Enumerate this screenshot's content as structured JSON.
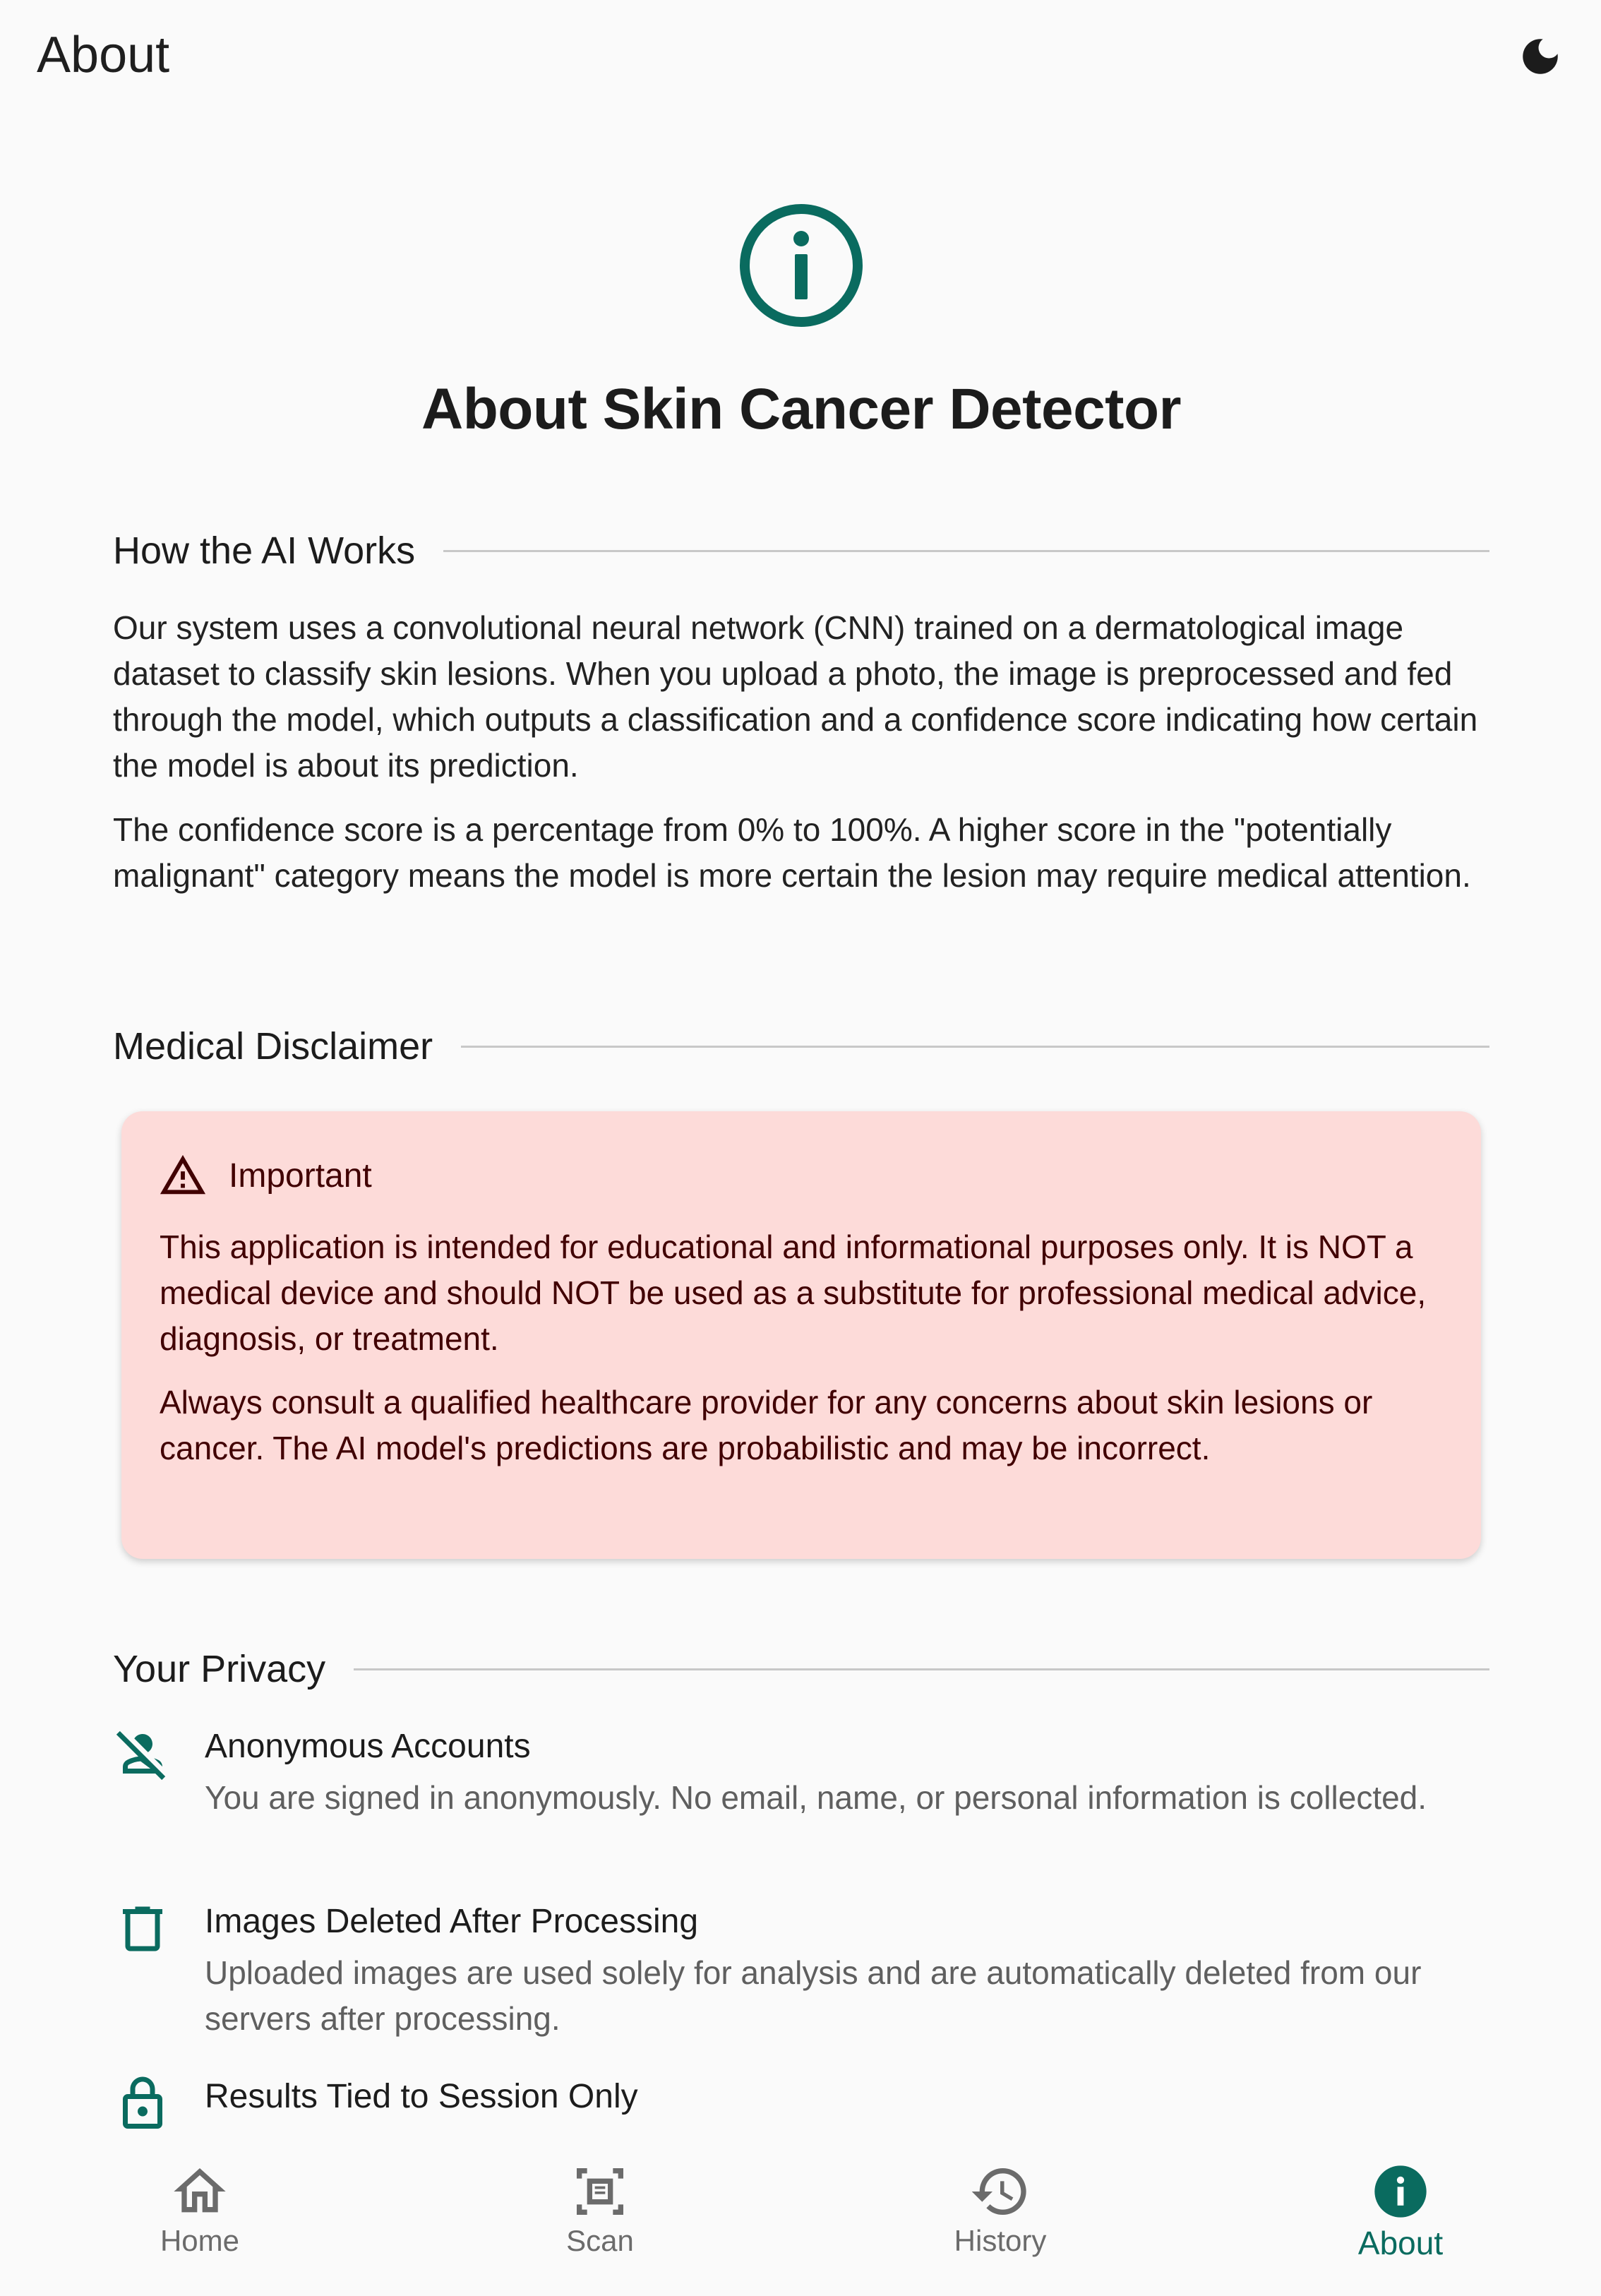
{
  "app_bar": {
    "title": "About",
    "theme_toggle_icon": "moon-icon"
  },
  "hero": {
    "icon": "info-circle-icon",
    "title": "About Skin Cancer Detector",
    "accent_color": "#0a6b5f"
  },
  "sections": {
    "how_ai_works": {
      "heading": "How the AI Works",
      "paragraphs": [
        "Our system uses a convolutional neural network (CNN) trained on a dermatological image dataset to classify skin lesions. When you upload a photo, the image is preprocessed and fed through the model, which outputs a classification and a confidence score indicating how certain the model is about its prediction.",
        "The confidence score is a percentage from 0% to 100%. A higher score in the \"potentially malignant\" category means the model is more certain the lesion may require medical attention."
      ]
    },
    "disclaimer": {
      "heading": "Medical Disclaimer",
      "card": {
        "icon": "warning-triangle-icon",
        "title": "Important",
        "background": "#fddbd9",
        "text_color": "#410002",
        "paragraphs": [
          "This application is intended for educational and informational purposes only. It is NOT a medical device and should NOT be used as a substitute for professional medical advice, diagnosis, or treatment.",
          "Always consult a qualified healthcare provider for any concerns about skin lesions or cancer. The AI model's predictions are probabilistic and may be incorrect."
        ]
      }
    },
    "privacy": {
      "heading": "Your Privacy",
      "items": [
        {
          "icon": "person-off-icon",
          "title": "Anonymous Accounts",
          "description": "You are signed in anonymously. No email, name, or personal information is collected."
        },
        {
          "icon": "trash-icon",
          "title": "Images Deleted After Processing",
          "description": "Uploaded images are used solely for analysis and are automatically deleted from our servers after processing."
        },
        {
          "icon": "lock-icon",
          "title": "Results Tied to Session Only",
          "description": ""
        }
      ]
    }
  },
  "bottom_nav": {
    "items": [
      {
        "label": "Home",
        "icon": "home-icon",
        "active": false
      },
      {
        "label": "Scan",
        "icon": "scan-icon",
        "active": false
      },
      {
        "label": "History",
        "icon": "history-icon",
        "active": false
      },
      {
        "label": "About",
        "icon": "info-icon",
        "active": true
      }
    ]
  }
}
